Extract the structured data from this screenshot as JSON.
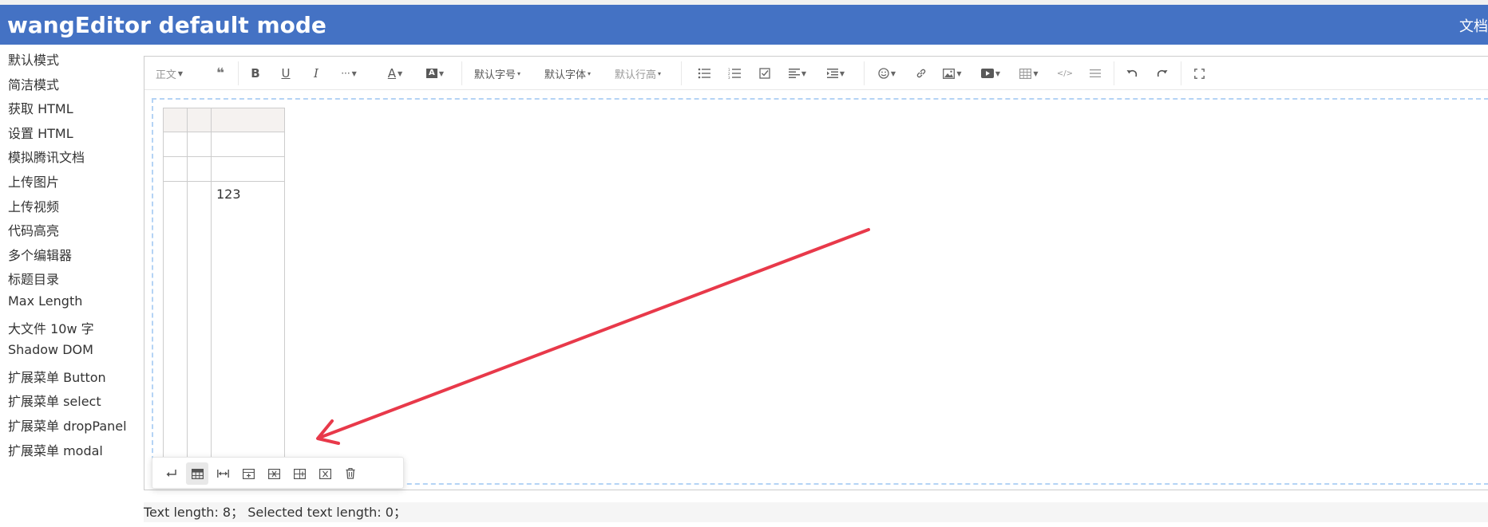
{
  "header": {
    "title": "wangEditor default mode",
    "doc_link": "文档"
  },
  "sidebar": {
    "items": [
      "默认模式",
      "简洁模式",
      "获取 HTML",
      "设置 HTML",
      "模拟腾讯文档",
      "上传图片",
      "上传视频",
      "代码高亮",
      "多个编辑器",
      "标题目录",
      "Max Length",
      "大文件 10w 字",
      "Shadow DOM",
      "扩展菜单 Button",
      "扩展菜单 select",
      "扩展菜单 dropPanel",
      "扩展菜单 modal"
    ]
  },
  "toolbar": {
    "heading_select": "正文",
    "font_size_select": "默认字号",
    "font_family_select": "默认字体",
    "line_height_select": "默认行高",
    "icons": {
      "blockquote": "quote-icon",
      "bold": "bold-icon",
      "underline": "underline-icon",
      "italic": "italic-icon",
      "more": "more-icon",
      "color": "font-color-icon",
      "bg_color": "bg-color-icon",
      "bulleted_list": "bulleted-list-icon",
      "numbered_list": "numbered-list-icon",
      "todo": "todo-icon",
      "justify": "align-icon",
      "indent": "indent-icon",
      "emotion": "emoji-icon",
      "link": "link-icon",
      "image": "image-icon",
      "video": "video-icon",
      "table": "table-icon",
      "code": "code-icon",
      "divider": "divider-icon",
      "undo": "undo-icon",
      "redo": "redo-icon",
      "fullscreen": "fullscreen-icon"
    }
  },
  "editor": {
    "table": {
      "rows": [
        [
          "",
          "",
          ""
        ],
        [
          "",
          "",
          ""
        ],
        [
          "",
          "",
          ""
        ],
        [
          "",
          "",
          "123"
        ]
      ]
    }
  },
  "table_menu": {
    "icons": [
      "enter-icon",
      "table-header-icon",
      "full-width-icon",
      "insert-row-icon",
      "delete-row-icon",
      "insert-col-icon",
      "delete-col-icon",
      "delete-table-icon"
    ]
  },
  "annotation": {
    "arrow_color": "#e8394a"
  },
  "status": {
    "text": "Text length: 8；  Selected text length: 0；"
  }
}
